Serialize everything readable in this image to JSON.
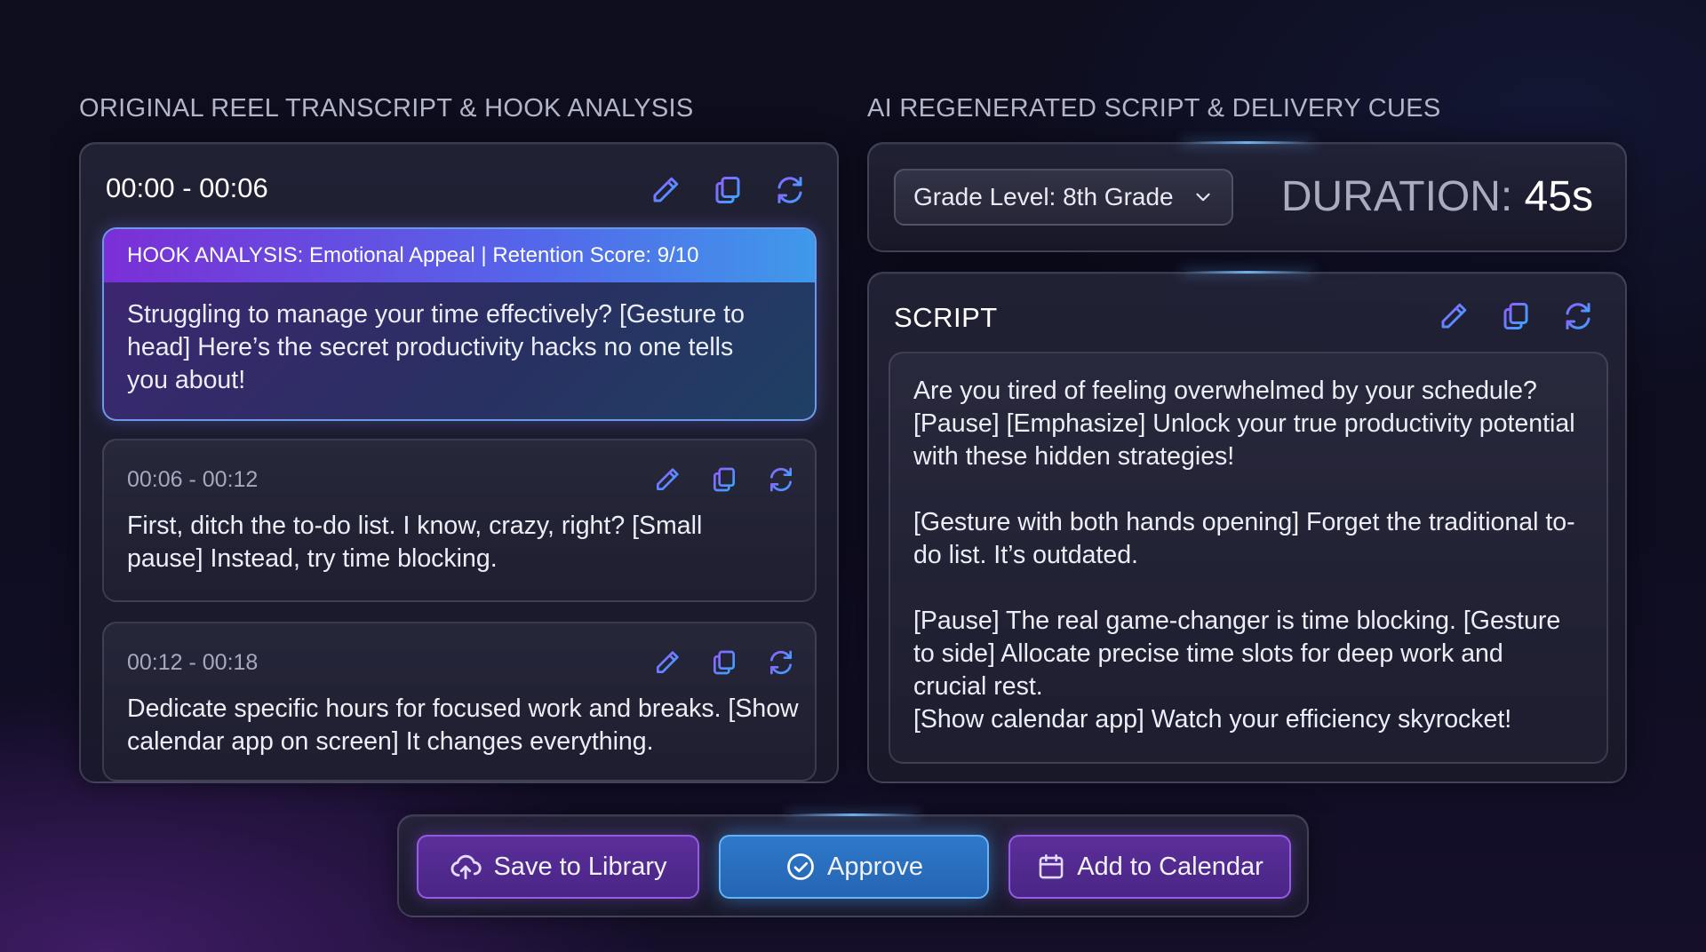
{
  "left_section": {
    "title": "ORIGINAL REEL TRANSCRIPT & HOOK ANALYSIS",
    "segments": [
      {
        "time": "00:00 - 00:06",
        "hook_label": "HOOK ANALYSIS: Emotional Appeal | Retention Score: 9/10",
        "text": "Struggling to manage your time effectively? [Gesture to head] Here’s the secret productivity hacks no one tells you about!"
      },
      {
        "time": "00:06 - 00:12",
        "text": "First, ditch the to-do list. I know, crazy, right? [Small pause] Instead, try time blocking."
      },
      {
        "time": "00:12 - 00:18",
        "text": "Dedicate specific hours for focused work and breaks. [Show calendar app on screen] It changes everything."
      }
    ]
  },
  "right_section": {
    "title": "AI REGENERATED SCRIPT & DELIVERY CUES",
    "grade_select": {
      "selected": "Grade Level: 8th Grade"
    },
    "duration": {
      "label": "DURATION:",
      "value": "45s"
    },
    "script": {
      "title": "SCRIPT",
      "paragraphs": [
        "Are you tired of feeling overwhelmed by your schedule? [Pause] [Emphasize] Unlock your true productivity potential with these hidden strategies!",
        "[Gesture with both hands opening] Forget the traditional to-do list. It’s outdated.",
        "[Pause] The real game-changer is time blocking. [Gesture to side] Allocate precise time slots for deep work and crucial rest.\n[Show calendar app] Watch your efficiency skyrocket!"
      ]
    }
  },
  "actions": {
    "save_label": "Save to Library",
    "approve_label": "Approve",
    "calendar_label": "Add to Calendar"
  },
  "icons": {
    "edit": "pencil-icon",
    "copy": "copy-icon",
    "regenerate": "refresh-icon",
    "save": "cloud-upload-icon",
    "approve": "check-circle-icon",
    "calendar": "calendar-icon",
    "dropdown": "chevron-down-icon"
  },
  "colors": {
    "background": "#0e0d20",
    "hook_gradient_start": "#7b2fd6",
    "hook_gradient_end": "#3f99ea",
    "icon_blue": "#56a8ff",
    "icon_purple": "#8b6cff",
    "approve_blue": "#2f78c9",
    "button_purple": "#5b2f9a"
  }
}
